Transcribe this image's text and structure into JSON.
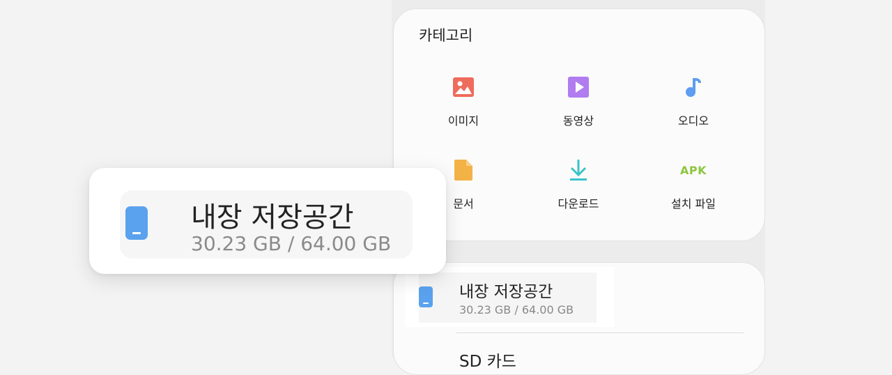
{
  "categories": {
    "title": "카테고리",
    "items": [
      {
        "label": "이미지",
        "icon": "image-icon",
        "color": "#ef6b5b"
      },
      {
        "label": "동영상",
        "icon": "video-icon",
        "color": "#b07cf0"
      },
      {
        "label": "오디오",
        "icon": "audio-icon",
        "color": "#5f9df0"
      },
      {
        "label": "문서",
        "icon": "document-icon",
        "color": "#f3b246"
      },
      {
        "label": "다운로드",
        "icon": "download-icon",
        "color": "#3cc2c9"
      },
      {
        "label": "설치 파일",
        "icon": "apk-icon",
        "icon_text": "APK",
        "color": "#8cc63f"
      }
    ]
  },
  "storage": {
    "internal": {
      "title": "내장 저장공간",
      "usage": "30.23 GB / 64.00 GB",
      "icon": "phone-storage-icon",
      "color": "#5aa2ee"
    },
    "sd_card": {
      "title": "SD 카드"
    }
  },
  "zoom": {
    "title": "내장 저장공간",
    "usage": "30.23 GB / 64.00 GB"
  }
}
